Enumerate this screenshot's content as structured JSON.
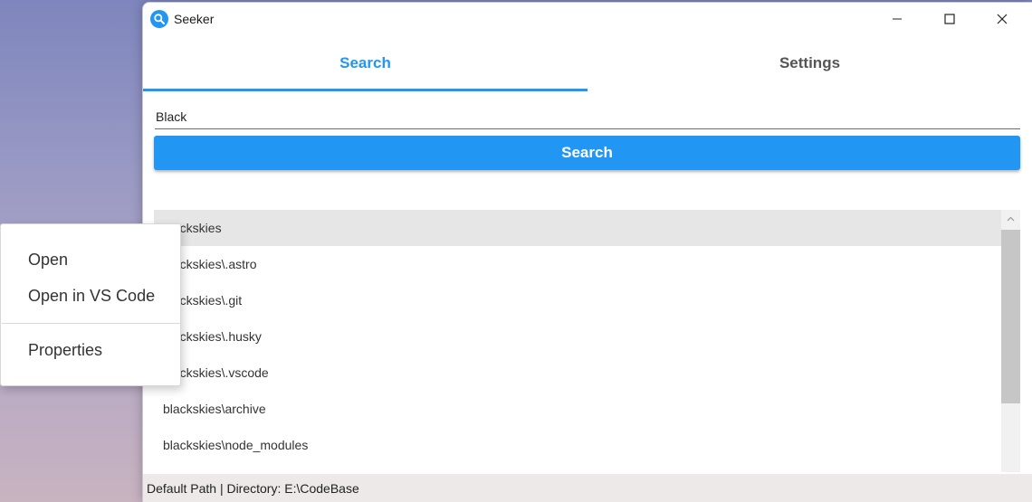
{
  "window": {
    "title": "Seeker",
    "app_icon": "search-icon"
  },
  "controls": {
    "minimize_icon": "minimize-icon",
    "maximize_icon": "maximize-icon",
    "close_icon": "close-icon"
  },
  "tabs": [
    {
      "label": "Search",
      "active": true
    },
    {
      "label": "Settings",
      "active": false
    }
  ],
  "search": {
    "value": "Black",
    "button_label": "Search"
  },
  "results": [
    {
      "label": "blackskies",
      "selected": true
    },
    {
      "label": "blackskies\\.astro"
    },
    {
      "label": "blackskies\\.git"
    },
    {
      "label": "blackskies\\.husky"
    },
    {
      "label": "blackskies\\.vscode"
    },
    {
      "label": "blackskies\\archive"
    },
    {
      "label": "blackskies\\node_modules"
    }
  ],
  "status": {
    "text": "Default Path | Directory: E:\\CodeBase"
  },
  "context_menu": {
    "items": [
      "Open",
      "Open in VS Code",
      "Properties"
    ]
  },
  "colors": {
    "accent": "#2196f3",
    "selected_row": "#e6e6e6",
    "status_bg": "#ece9e8"
  }
}
